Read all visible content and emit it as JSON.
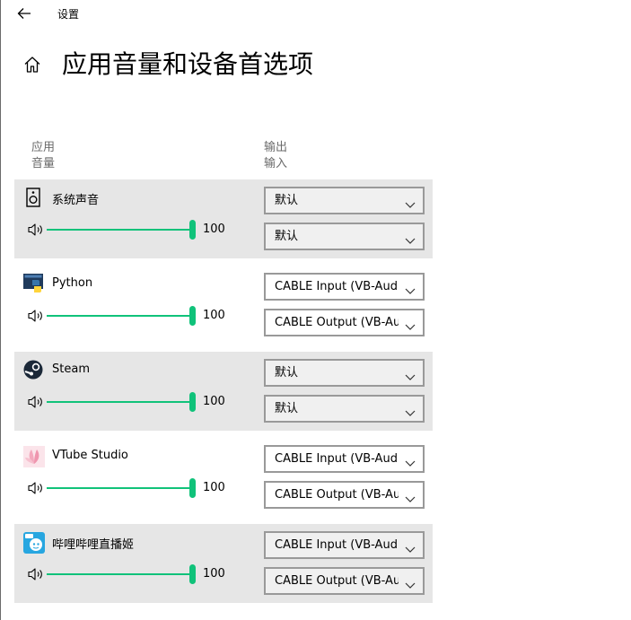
{
  "window": {
    "title": "设置"
  },
  "page": {
    "title": "应用音量和设备首选项"
  },
  "columns": {
    "app_line1": "应用",
    "app_line2": "音量",
    "device_line1": "输出",
    "device_line2": "输入"
  },
  "apps": [
    {
      "name": "系统声音",
      "icon": "speaker-icon",
      "volume": 100,
      "volume_text": "100",
      "output": "默认",
      "input": "默认",
      "shaded": true
    },
    {
      "name": "Python",
      "icon": "python-icon",
      "volume": 100,
      "volume_text": "100",
      "output": "CABLE Input (VB-Audio Virtual Cable)",
      "input": "CABLE Output (VB-Audio Virtual Cable)",
      "shaded": false
    },
    {
      "name": "Steam",
      "icon": "steam-icon",
      "volume": 100,
      "volume_text": "100",
      "output": "默认",
      "input": "默认",
      "shaded": true
    },
    {
      "name": "VTube Studio",
      "icon": "vtube-studio-icon",
      "volume": 100,
      "volume_text": "100",
      "output": "CABLE Input (VB-Audio Virtual Cable)",
      "input": "CABLE Output (VB-Audio Virtual Cable)",
      "shaded": false
    },
    {
      "name": "哔哩哔哩直播姬",
      "icon": "bilibili-live-icon",
      "volume": 100,
      "volume_text": "100",
      "output": "CABLE Input (VB-Audio Virtual Cable)",
      "input": "CABLE Output (VB-Audio Virtual Cable)",
      "shaded": true
    }
  ],
  "colors": {
    "accent": "#10c27a",
    "row_shade": "#e6e6e6"
  }
}
